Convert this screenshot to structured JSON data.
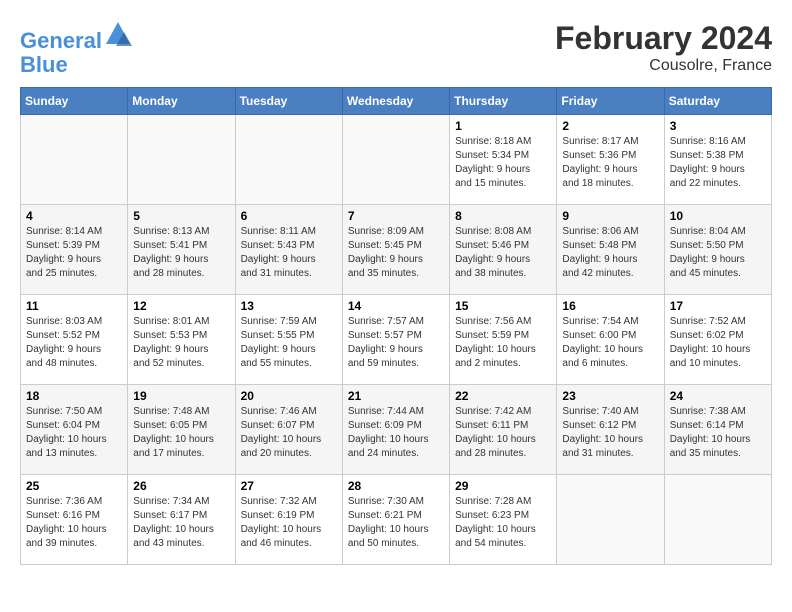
{
  "logo": {
    "line1": "General",
    "line2": "Blue"
  },
  "title": "February 2024",
  "subtitle": "Cousolre, France",
  "days_header": [
    "Sunday",
    "Monday",
    "Tuesday",
    "Wednesday",
    "Thursday",
    "Friday",
    "Saturday"
  ],
  "weeks": [
    [
      {
        "day": "",
        "info": ""
      },
      {
        "day": "",
        "info": ""
      },
      {
        "day": "",
        "info": ""
      },
      {
        "day": "",
        "info": ""
      },
      {
        "day": "1",
        "info": "Sunrise: 8:18 AM\nSunset: 5:34 PM\nDaylight: 9 hours\nand 15 minutes."
      },
      {
        "day": "2",
        "info": "Sunrise: 8:17 AM\nSunset: 5:36 PM\nDaylight: 9 hours\nand 18 minutes."
      },
      {
        "day": "3",
        "info": "Sunrise: 8:16 AM\nSunset: 5:38 PM\nDaylight: 9 hours\nand 22 minutes."
      }
    ],
    [
      {
        "day": "4",
        "info": "Sunrise: 8:14 AM\nSunset: 5:39 PM\nDaylight: 9 hours\nand 25 minutes."
      },
      {
        "day": "5",
        "info": "Sunrise: 8:13 AM\nSunset: 5:41 PM\nDaylight: 9 hours\nand 28 minutes."
      },
      {
        "day": "6",
        "info": "Sunrise: 8:11 AM\nSunset: 5:43 PM\nDaylight: 9 hours\nand 31 minutes."
      },
      {
        "day": "7",
        "info": "Sunrise: 8:09 AM\nSunset: 5:45 PM\nDaylight: 9 hours\nand 35 minutes."
      },
      {
        "day": "8",
        "info": "Sunrise: 8:08 AM\nSunset: 5:46 PM\nDaylight: 9 hours\nand 38 minutes."
      },
      {
        "day": "9",
        "info": "Sunrise: 8:06 AM\nSunset: 5:48 PM\nDaylight: 9 hours\nand 42 minutes."
      },
      {
        "day": "10",
        "info": "Sunrise: 8:04 AM\nSunset: 5:50 PM\nDaylight: 9 hours\nand 45 minutes."
      }
    ],
    [
      {
        "day": "11",
        "info": "Sunrise: 8:03 AM\nSunset: 5:52 PM\nDaylight: 9 hours\nand 48 minutes."
      },
      {
        "day": "12",
        "info": "Sunrise: 8:01 AM\nSunset: 5:53 PM\nDaylight: 9 hours\nand 52 minutes."
      },
      {
        "day": "13",
        "info": "Sunrise: 7:59 AM\nSunset: 5:55 PM\nDaylight: 9 hours\nand 55 minutes."
      },
      {
        "day": "14",
        "info": "Sunrise: 7:57 AM\nSunset: 5:57 PM\nDaylight: 9 hours\nand 59 minutes."
      },
      {
        "day": "15",
        "info": "Sunrise: 7:56 AM\nSunset: 5:59 PM\nDaylight: 10 hours\nand 2 minutes."
      },
      {
        "day": "16",
        "info": "Sunrise: 7:54 AM\nSunset: 6:00 PM\nDaylight: 10 hours\nand 6 minutes."
      },
      {
        "day": "17",
        "info": "Sunrise: 7:52 AM\nSunset: 6:02 PM\nDaylight: 10 hours\nand 10 minutes."
      }
    ],
    [
      {
        "day": "18",
        "info": "Sunrise: 7:50 AM\nSunset: 6:04 PM\nDaylight: 10 hours\nand 13 minutes."
      },
      {
        "day": "19",
        "info": "Sunrise: 7:48 AM\nSunset: 6:05 PM\nDaylight: 10 hours\nand 17 minutes."
      },
      {
        "day": "20",
        "info": "Sunrise: 7:46 AM\nSunset: 6:07 PM\nDaylight: 10 hours\nand 20 minutes."
      },
      {
        "day": "21",
        "info": "Sunrise: 7:44 AM\nSunset: 6:09 PM\nDaylight: 10 hours\nand 24 minutes."
      },
      {
        "day": "22",
        "info": "Sunrise: 7:42 AM\nSunset: 6:11 PM\nDaylight: 10 hours\nand 28 minutes."
      },
      {
        "day": "23",
        "info": "Sunrise: 7:40 AM\nSunset: 6:12 PM\nDaylight: 10 hours\nand 31 minutes."
      },
      {
        "day": "24",
        "info": "Sunrise: 7:38 AM\nSunset: 6:14 PM\nDaylight: 10 hours\nand 35 minutes."
      }
    ],
    [
      {
        "day": "25",
        "info": "Sunrise: 7:36 AM\nSunset: 6:16 PM\nDaylight: 10 hours\nand 39 minutes."
      },
      {
        "day": "26",
        "info": "Sunrise: 7:34 AM\nSunset: 6:17 PM\nDaylight: 10 hours\nand 43 minutes."
      },
      {
        "day": "27",
        "info": "Sunrise: 7:32 AM\nSunset: 6:19 PM\nDaylight: 10 hours\nand 46 minutes."
      },
      {
        "day": "28",
        "info": "Sunrise: 7:30 AM\nSunset: 6:21 PM\nDaylight: 10 hours\nand 50 minutes."
      },
      {
        "day": "29",
        "info": "Sunrise: 7:28 AM\nSunset: 6:23 PM\nDaylight: 10 hours\nand 54 minutes."
      },
      {
        "day": "",
        "info": ""
      },
      {
        "day": "",
        "info": ""
      }
    ]
  ]
}
